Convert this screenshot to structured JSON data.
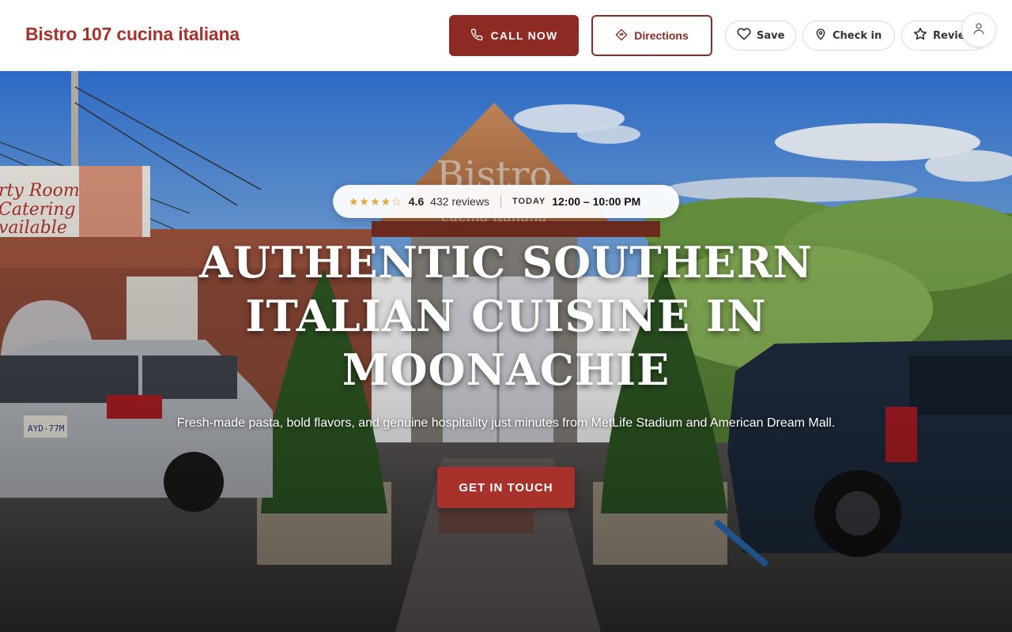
{
  "header": {
    "brand": "Bistro 107 cucina italiana",
    "call_label": "CALL NOW",
    "directions_label": "Directions",
    "save_label": "Save",
    "checkin_label": "Check in",
    "review_label": "Review"
  },
  "hero": {
    "stars": "★★★★☆",
    "rating": "4.6",
    "reviews": "432 reviews",
    "today_label": "TODAY",
    "hours": "12:00 – 10:00 PM",
    "headline": "AUTHENTIC SOUTHERN ITALIAN CUISINE IN MOONACHIE",
    "subline": "Fresh-made pasta, bold flavors, and genuine hospitality just minutes from MetLife Stadium and American Dream Mall.",
    "cta_label": "GET IN TOUCH"
  },
  "photo": {
    "sign_text": "Bistro",
    "sign_sub": "cucina italiana",
    "banner_text": "rty Room\nCatering\nvailable",
    "plate_text": "AYD-77M"
  },
  "colors": {
    "brand": "#a8322b",
    "primary_dark": "#8e2a24",
    "star": "#e8a33a"
  },
  "icons": {
    "call": "phone-icon",
    "directions": "directions-icon",
    "save": "heart-icon",
    "checkin": "map-pin-icon",
    "review": "star-icon",
    "account": "user-icon"
  }
}
